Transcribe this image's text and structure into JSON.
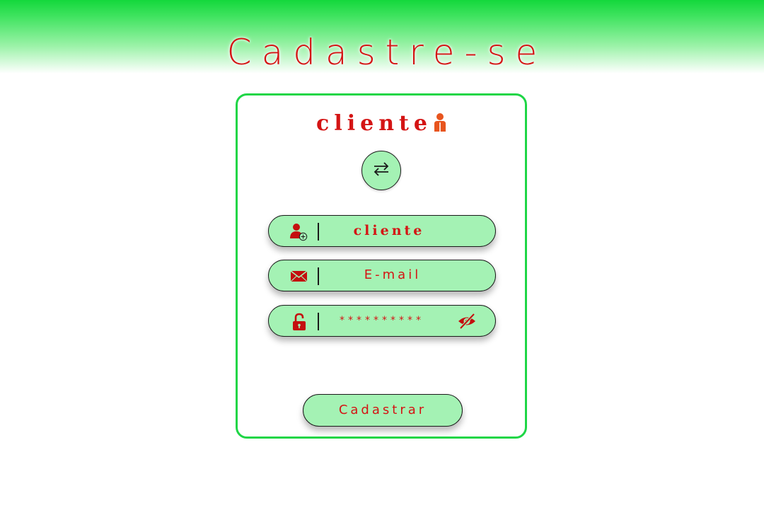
{
  "header": {
    "title": "Cadastre-se",
    "background_color": "#14d83c"
  },
  "card": {
    "heading": "cliente",
    "heading_icon": "person-icon",
    "border_color": "#1ed646",
    "switch_icon": "swap-arrows-icon"
  },
  "form": {
    "name_field": {
      "value": "cliente",
      "icon": "add-user-icon"
    },
    "email_field": {
      "placeholder": "E-mail",
      "icon": "envelope-icon"
    },
    "password_field": {
      "value": "**********",
      "icon": "unlock-icon",
      "toggle_icon": "eye-off-icon"
    },
    "submit_label": "Cadastrar"
  },
  "colors": {
    "accent_text": "#d41414",
    "field_fill": "#a4f2b4",
    "person_icon": "#e8551e"
  }
}
